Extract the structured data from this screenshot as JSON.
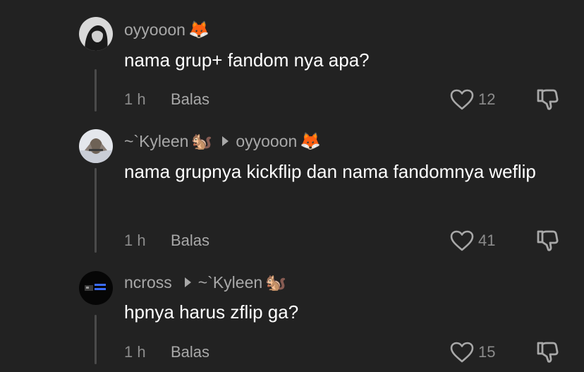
{
  "comments": [
    {
      "username": "oyyooon",
      "username_emoji": "🦊",
      "reply_to": "",
      "reply_to_emoji": "",
      "text": "nama grup+ fandom nya apa?",
      "time": "1 h",
      "reply_label": "Balas",
      "likes": "12"
    },
    {
      "username": "~`Kyleen",
      "username_emoji": "🐿️",
      "reply_to": "oyyooon",
      "reply_to_emoji": "🦊",
      "text": "nama grupnya kickflip dan nama fandomnya weflip",
      "time": "1 h",
      "reply_label": "Balas",
      "likes": "41"
    },
    {
      "username": "ncross",
      "username_emoji": "",
      "reply_to": "~`Kyleen",
      "reply_to_emoji": "🐿️",
      "text": "hpnya harus zflip ga?",
      "time": "1 h",
      "reply_label": "Balas",
      "likes": "15"
    }
  ],
  "icons": {
    "like": "heart-outline-icon",
    "dislike": "thumbs-down-outline-icon",
    "reply_arrow": "triangle-right-icon"
  },
  "colors": {
    "background": "#222222",
    "primary_text": "#ffffff",
    "secondary_text": "#a8a8a8",
    "muted_text": "#8c8c8c",
    "thread_line": "#4a4a4a"
  }
}
